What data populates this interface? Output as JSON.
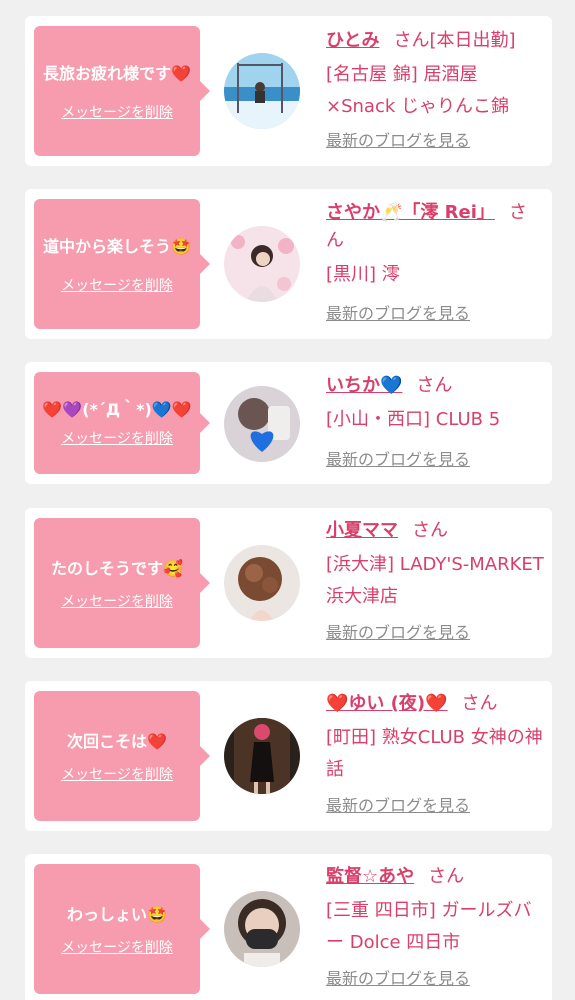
{
  "cards": [
    {
      "message": "長旅お疲れ様です❤️",
      "delete_label": "メッセージを削除",
      "name": "ひとみ",
      "suffix": "さん[本日出勤]",
      "shop": "[名古屋 錦] 居酒屋×Snack じゃりんこ錦",
      "blog_label": "最新のブログを見る",
      "avatar_icon": "beach-swing-photo"
    },
    {
      "message": "道中から楽しそう🤩",
      "delete_label": "メッセージを削除",
      "name": "さやか🥂「澪 Rei」",
      "suffix": "さん",
      "shop": "[黒川] 澪",
      "blog_label": "最新のブログを見る",
      "avatar_icon": "woman-flowers-photo"
    },
    {
      "message": "❤️💜(*´Д｀*)💙❤️",
      "delete_label": "メッセージを削除",
      "name": "いちか💙",
      "suffix": "さん",
      "shop": "[小山・西口] CLUB 5",
      "blog_label": "最新のブログを見る",
      "avatar_icon": "blue-heart-selfie-photo"
    },
    {
      "message": "たのしそうです🥰",
      "delete_label": "メッセージを削除",
      "name": "小夏ママ",
      "suffix": "さん",
      "shop": "[浜大津] LADY'S-MARKET 浜大津店",
      "blog_label": "最新のブログを見る",
      "avatar_icon": "hair-portrait-photo"
    },
    {
      "message": "次回こそは❤️",
      "delete_label": "メッセージを削除",
      "name": "❤️ゆい (夜)❤️",
      "suffix": "さん",
      "shop": "[町田] 熟女CLUB 女神の神話",
      "blog_label": "最新のブログを見る",
      "avatar_icon": "black-dress-photo"
    },
    {
      "message": "わっしょい🤩",
      "delete_label": "メッセージを削除",
      "name": "監督☆あや",
      "suffix": "さん",
      "shop": "[三重 四日市] ガールズバー Dolce 四日市",
      "blog_label": "最新のブログを見る",
      "avatar_icon": "mask-selfie-photo"
    }
  ]
}
